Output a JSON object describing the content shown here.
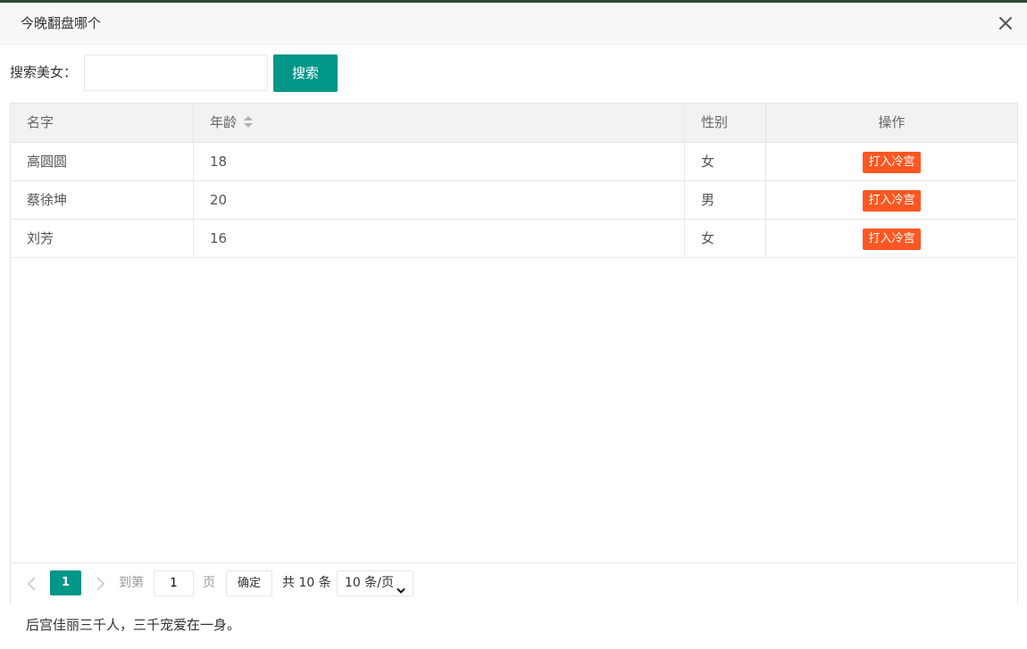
{
  "dialog": {
    "title": "今晚翻盘哪个"
  },
  "search": {
    "label": "搜索美女：",
    "value": "",
    "placeholder": "",
    "button_label": "搜索"
  },
  "table": {
    "headers": {
      "name": "名字",
      "age": "年龄",
      "gender": "性别",
      "action": "操作"
    },
    "rows": [
      {
        "name": "高圆圆",
        "age": "18",
        "gender": "女",
        "action": "打入冷宫"
      },
      {
        "name": "蔡徐坤",
        "age": "20",
        "gender": "男",
        "action": "打入冷宫"
      },
      {
        "name": "刘芳",
        "age": "16",
        "gender": "女",
        "action": "打入冷宫"
      }
    ]
  },
  "pager": {
    "current_page": "1",
    "goto_label": "到第",
    "goto_value": "1",
    "page_unit": "页",
    "confirm_label": "确定",
    "total_label": "共 10 条",
    "page_size_label": "10 条/页"
  },
  "footer": {
    "note": "后宫佳丽三千人，三千宠爱在一身。"
  },
  "colors": {
    "primary": "#009688",
    "danger": "#ff5722"
  },
  "icons": {
    "close": "close-icon",
    "sort": "sort-icon",
    "prev": "chevron-left-icon",
    "next": "chevron-right-icon",
    "select": "chevron-down-icon"
  }
}
